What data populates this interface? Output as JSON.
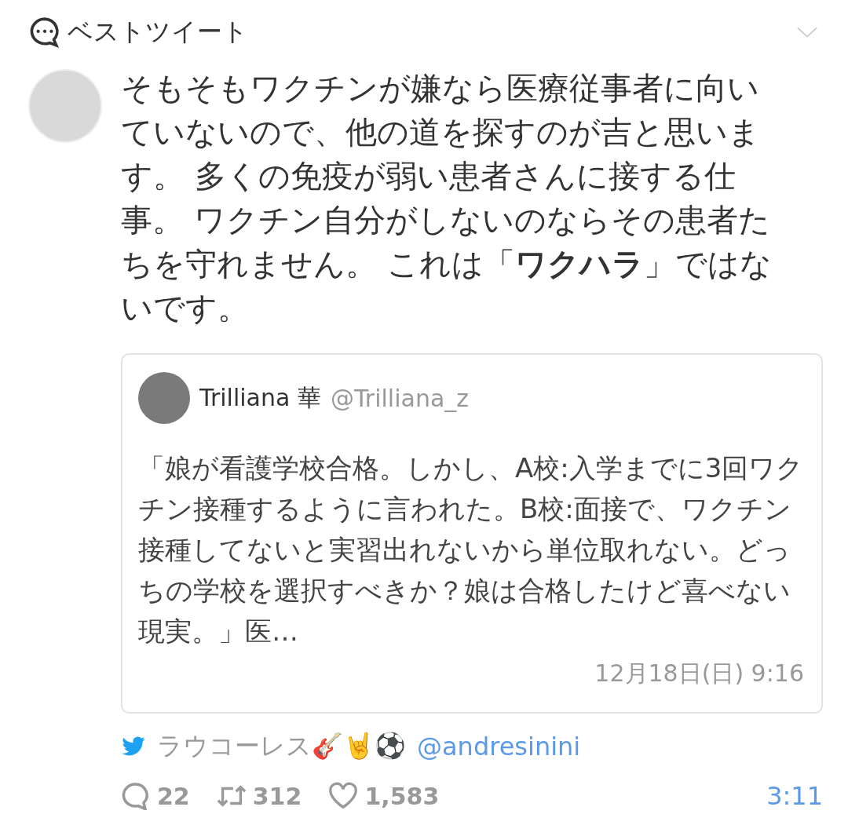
{
  "header": {
    "title": "ベストツイート"
  },
  "tweet": {
    "text": "そもそもワクチンが嫌なら医療従事者に向いていないので、他の道を探すのが吉と思います。 多くの免疫が弱い患者さんに接する仕事。 ワクチン自分がしないのならその患者たちを守れません。 これは「**ワクハラ**」ではないです。",
    "quoted": {
      "name": "Trilliana 華",
      "handle": "@Trilliana_z",
      "text": "「娘が看護学校合格。しかし、A校:入学までに3回ワクチン接種するように言われた。B校:面接で、ワクチン接種してないと実習出れないから単位取れない。どっちの学校を選択すべきか？娘は合格したけど喜べない現実。」医…",
      "date": "12月18日(日) 9:16"
    },
    "author": {
      "name": "ラウコーレス🎸🤘⚽",
      "handle": "@andresinini"
    },
    "stats": [
      {
        "kind": "reply",
        "count": "22"
      },
      {
        "kind": "retweet",
        "count": "312"
      },
      {
        "kind": "like",
        "count": "1,583"
      }
    ],
    "time": "3:11"
  }
}
